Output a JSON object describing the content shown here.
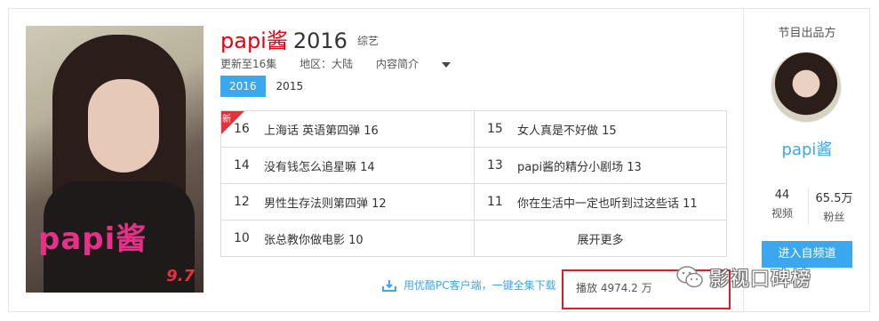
{
  "show": {
    "name": "papi酱",
    "year": "2016",
    "genre": "综艺",
    "poster_logo": "papi酱",
    "poster_score": "9.7"
  },
  "meta": {
    "updated": "更新至16集",
    "region": "地区：大陆",
    "intro_toggle": "内容简介"
  },
  "year_tabs": [
    {
      "label": "2016",
      "active": true
    },
    {
      "label": "2015",
      "active": false
    }
  ],
  "episodes": {
    "new_badge": "新",
    "rows": [
      [
        {
          "num": "16",
          "title": "上海话 英语第四弹 16"
        },
        {
          "num": "15",
          "title": "女人真是不好做 15"
        }
      ],
      [
        {
          "num": "14",
          "title": "没有钱怎么追星嘛 14"
        },
        {
          "num": "13",
          "title": "papi酱的精分小剧场 13"
        }
      ],
      [
        {
          "num": "12",
          "title": "男性生存法则第四弹 12"
        },
        {
          "num": "11",
          "title": "你在生活中一定也听到过这些话 11"
        }
      ],
      [
        {
          "num": "10",
          "title": "张总教你做电影 10"
        }
      ]
    ],
    "more_label": "展开更多"
  },
  "download": {
    "text": "用优酷PC客户端，一键全集下载"
  },
  "plays": {
    "text": "播放 4974.2 万"
  },
  "owner": {
    "section_title": "节目出品方",
    "name": "papi酱",
    "videos_value": "44",
    "videos_label": "视频",
    "fans_value": "65.5万",
    "fans_label": "粉丝",
    "channel_button": "进入自频道"
  },
  "watermark": {
    "text": "影视口碑榜"
  },
  "colors": {
    "accent_blue": "#3ba7ee",
    "title_red": "#e60012",
    "highlight_red": "#d61f2b"
  }
}
